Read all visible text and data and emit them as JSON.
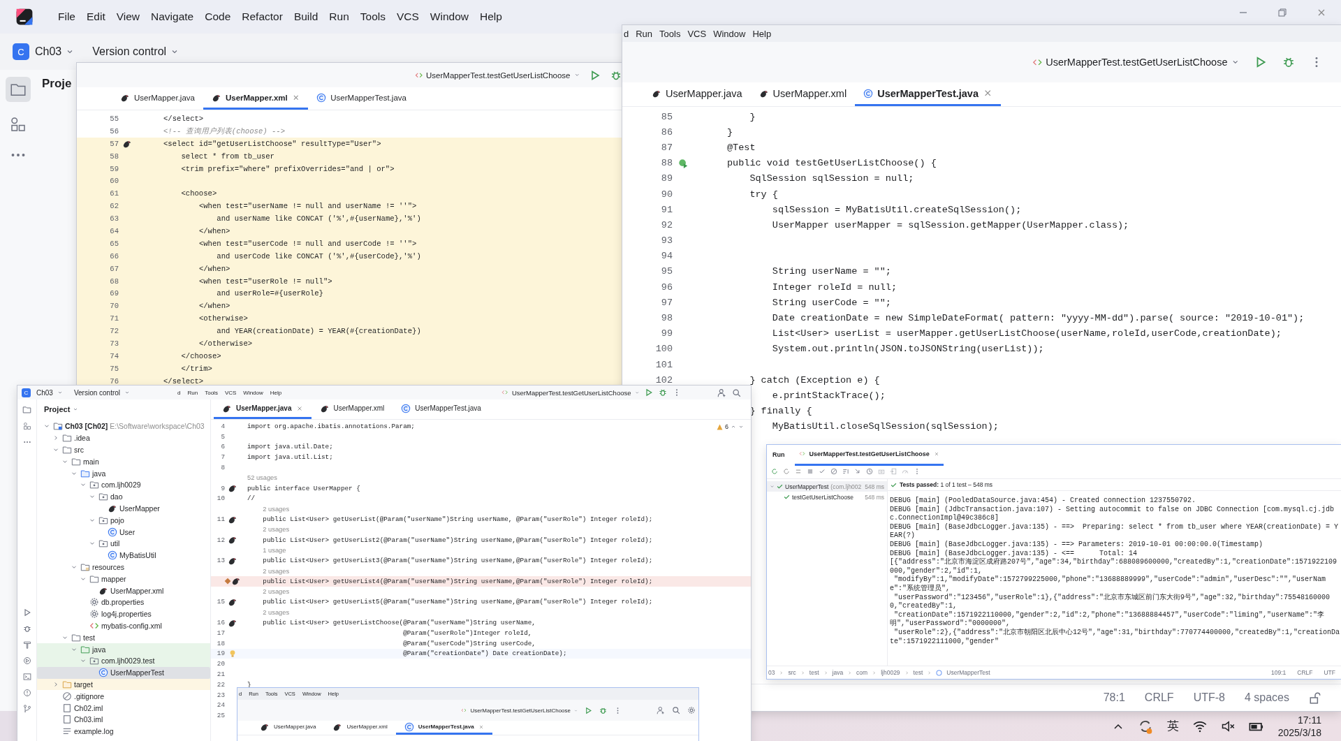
{
  "ide": {
    "menu": [
      "File",
      "Edit",
      "View",
      "Navigate",
      "Code",
      "Refactor",
      "Build",
      "Run",
      "Tools",
      "VCS",
      "Window",
      "Help"
    ],
    "project_letter": "C",
    "project": "Ch03",
    "vcs": "Version control",
    "pane_title": "Proje"
  },
  "xml_window": {
    "run_config": "UserMapperTest.testGetUserListChoose",
    "tabs": [
      {
        "label": "UserMapper.java",
        "kind": "mapper",
        "selected": false
      },
      {
        "label": "UserMapper.xml",
        "kind": "mapper",
        "selected": true
      },
      {
        "label": "UserMapperTest.java",
        "kind": "class",
        "selected": false
      }
    ],
    "lines": [
      {
        "n": "55",
        "text": "</select>",
        "kind": "code",
        "marked": false
      },
      {
        "n": "56",
        "text": "<!-- 查询用户列表(choose) -->",
        "kind": "comment",
        "marked": false
      },
      {
        "n": "57",
        "text": "<select id=\"getUserListChoose\" resultType=\"User\">",
        "kind": "injected",
        "marked": true
      },
      {
        "n": "58",
        "text": "    select * from tb_user",
        "kind": "injected",
        "marked": false
      },
      {
        "n": "59",
        "text": "    <trim prefix=\"where\" prefixOverrides=\"and | or\">",
        "kind": "injected",
        "marked": false
      },
      {
        "n": "60",
        "kind": "injected",
        "marked": false
      },
      {
        "n": "61",
        "text": "    <choose>",
        "kind": "injected",
        "marked": false
      },
      {
        "n": "62",
        "text": "        <when test=\"userName != null and userName != ''\">",
        "kind": "injected",
        "marked": false
      },
      {
        "n": "63",
        "text": "            and userName like CONCAT ('%',#{userName},'%')",
        "kind": "injected",
        "marked": false
      },
      {
        "n": "64",
        "text": "        </when>",
        "kind": "injected",
        "marked": false
      },
      {
        "n": "65",
        "text": "        <when test=\"userCode != null and userCode != ''\">",
        "kind": "injected",
        "marked": false
      },
      {
        "n": "66",
        "text": "            and userCode like CONCAT ('%',#{userCode},'%')",
        "kind": "injected",
        "marked": false
      },
      {
        "n": "67",
        "text": "        </when>",
        "kind": "injected",
        "marked": false
      },
      {
        "n": "68",
        "text": "        <when test=\"userRole != null\">",
        "kind": "injected",
        "marked": false
      },
      {
        "n": "69",
        "text": "            and userRole=#{userRole}",
        "kind": "injected",
        "marked": false
      },
      {
        "n": "70",
        "text": "        </when>",
        "kind": "injected",
        "marked": false
      },
      {
        "n": "71",
        "text": "        <otherwise>",
        "kind": "injected",
        "marked": false
      },
      {
        "n": "72",
        "text": "            and YEAR(creationDate) = YEAR(#{creationDate})",
        "kind": "injected",
        "marked": false
      },
      {
        "n": "73",
        "text": "        </otherwise>",
        "kind": "injected",
        "marked": false
      },
      {
        "n": "74",
        "text": "    </choose>",
        "kind": "injected",
        "marked": false
      },
      {
        "n": "75",
        "text": "    </trim>",
        "kind": "injected",
        "marked": false
      },
      {
        "n": "76",
        "text": "</select>",
        "kind": "injected",
        "marked": false
      }
    ]
  },
  "test_window": {
    "menu": [
      "d",
      "Run",
      "Tools",
      "VCS",
      "Window",
      "Help"
    ],
    "run_config": "UserMapperTest.testGetUserListChoose",
    "tabs": [
      {
        "label": "UserMapper.java",
        "kind": "mapper",
        "selected": false
      },
      {
        "label": "UserMapper.xml",
        "kind": "mapper",
        "selected": false
      },
      {
        "label": "UserMapperTest.java",
        "kind": "class",
        "selected": true
      }
    ],
    "lines": [
      {
        "n": "85",
        "text": "    }",
        "kind": "code",
        "marked": false
      },
      {
        "n": "86",
        "text": "}",
        "kind": "code",
        "marked": false
      },
      {
        "n": "87",
        "text": "@Test",
        "kind": "code",
        "marked": false
      },
      {
        "n": "88",
        "text": "public void testGetUserListChoose() {",
        "kind": "code",
        "marked": true
      },
      {
        "n": "89",
        "text": "    SqlSession sqlSession = null;",
        "kind": "code",
        "marked": false
      },
      {
        "n": "90",
        "text": "    try {",
        "kind": "code",
        "marked": false
      },
      {
        "n": "91",
        "text": "        sqlSession = MyBatisUtil.createSqlSession();",
        "kind": "code",
        "marked": false
      },
      {
        "n": "92",
        "text": "        UserMapper userMapper = sqlSession.getMapper(UserMapper.class);",
        "kind": "code",
        "marked": false
      },
      {
        "n": "93",
        "marked": false
      },
      {
        "n": "94",
        "marked": false
      },
      {
        "n": "95",
        "text": "        String userName = \"\";",
        "kind": "code",
        "marked": false
      },
      {
        "n": "96",
        "text": "        Integer roleId = null;",
        "kind": "code",
        "marked": false
      },
      {
        "n": "97",
        "text": "        String userCode = \"\";",
        "kind": "code",
        "marked": false
      },
      {
        "n": "98",
        "text": "        Date creationDate = new SimpleDateFormat( pattern: \"yyyy-MM-dd\").parse( source: \"2019-10-01\");",
        "kind": "code",
        "marked": false
      },
      {
        "n": "99",
        "text": "        List<User> userList = userMapper.getUserListChoose(userName,roleId,userCode,creationDate);",
        "kind": "code",
        "marked": false
      },
      {
        "n": "100",
        "text": "        System.out.println(JSON.toJSONString(userList));",
        "kind": "code",
        "marked": false
      },
      {
        "n": "101",
        "marked": false
      },
      {
        "n": "102",
        "text": "    } catch (Exception e) {",
        "kind": "code",
        "marked": false
      },
      {
        "text": "        e.printStackTrace();",
        "kind": "code"
      },
      {
        "text": "    } finally {",
        "kind": "code"
      },
      {
        "text": "        MyBatisUtil.closeSqlSession(sqlSession);",
        "kind": "code"
      }
    ],
    "status": [
      "78:1",
      "CRLF",
      "UTF-8",
      "4 spaces"
    ]
  },
  "mapper_window": {
    "project_letter": "C",
    "project": "Ch03",
    "vcs": "Version control",
    "menu": [
      "d",
      "Run",
      "Tools",
      "VCS",
      "Window",
      "Help"
    ],
    "run_config": "UserMapperTest.testGetUserListChoose",
    "tree_title": "Project",
    "tree": [
      {
        "label": "Ch03 [Ch02]",
        "path": "E:\\Software\\workspace\\Ch03",
        "kind": "module",
        "expanded": true,
        "selected": false,
        "children": [
          {
            "label": ".idea",
            "kind": "folder",
            "expanded": false,
            "selected": false
          },
          {
            "label": "src",
            "kind": "folder",
            "expanded": true,
            "selected": false,
            "children": [
              {
                "label": "main",
                "kind": "folder",
                "expanded": true,
                "selected": false,
                "children": [
                  {
                    "label": "java",
                    "kind": "source",
                    "expanded": true,
                    "selected": false,
                    "children": [
                      {
                        "label": "com.ljh0029",
                        "kind": "package",
                        "expanded": true,
                        "selected": false,
                        "children": [
                          {
                            "label": "dao",
                            "kind": "package",
                            "expanded": true,
                            "selected": false,
                            "children": [
                              {
                                "label": "UserMapper",
                                "kind": "mapper",
                                "selected": false
                              }
                            ]
                          },
                          {
                            "label": "pojo",
                            "kind": "package",
                            "expanded": true,
                            "selected": false,
                            "children": [
                              {
                                "label": "User",
                                "kind": "class",
                                "selected": false
                              }
                            ]
                          },
                          {
                            "label": "util",
                            "kind": "package",
                            "expanded": true,
                            "selected": false,
                            "children": [
                              {
                                "label": "MyBatisUtil",
                                "kind": "class",
                                "selected": false
                              }
                            ]
                          }
                        ]
                      }
                    ]
                  },
                  {
                    "label": "resources",
                    "kind": "resources",
                    "expanded": true,
                    "selected": false,
                    "children": [
                      {
                        "label": "mapper",
                        "kind": "folder",
                        "expanded": true,
                        "selected": false,
                        "children": [
                          {
                            "label": "UserMapper.xml",
                            "kind": "mapper",
                            "selected": false
                          }
                        ]
                      },
                      {
                        "label": "db.properties",
                        "kind": "properties",
                        "selected": false
                      },
                      {
                        "label": "log4j.properties",
                        "kind": "properties",
                        "selected": false
                      },
                      {
                        "label": "mybatis-config.xml",
                        "kind": "xml",
                        "selected": false
                      }
                    ]
                  }
                ]
              },
              {
                "label": "test",
                "kind": "folder",
                "expanded": true,
                "selected": false,
                "children": [
                  {
                    "label": "java",
                    "kind": "testsource",
                    "expanded": true,
                    "selected": false,
                    "children": [
                      {
                        "label": "com.ljh0029.test",
                        "kind": "package",
                        "expanded": true,
                        "selected": false,
                        "children": [
                          {
                            "label": "UserMapperTest",
                            "kind": "class",
                            "selected": true
                          }
                        ]
                      }
                    ]
                  }
                ]
              }
            ]
          },
          {
            "label": "target",
            "kind": "excluded",
            "expanded": false,
            "selected": false
          },
          {
            "label": ".gitignore",
            "kind": "ignore",
            "selected": false
          },
          {
            "label": "Ch02.iml",
            "kind": "file",
            "selected": false
          },
          {
            "label": "Ch03.iml",
            "kind": "file",
            "selected": false
          },
          {
            "label": "example.log",
            "kind": "log",
            "selected": false
          }
        ]
      }
    ],
    "tabs": [
      {
        "label": "UserMapper.java",
        "kind": "mapper",
        "selected": true
      },
      {
        "label": "UserMapper.xml",
        "kind": "mapper",
        "selected": false
      },
      {
        "label": "UserMapperTest.java",
        "kind": "class",
        "selected": false
      }
    ],
    "warnings": "6",
    "lines": [
      {
        "n": "4",
        "text": "import org.apache.ibatis.annotations.Param;",
        "kind": "code",
        "marked": false
      },
      {
        "n": "5",
        "marked": false
      },
      {
        "n": "6",
        "text": "import java.util.Date;",
        "kind": "code",
        "marked": false
      },
      {
        "n": "7",
        "text": "import java.util.List;",
        "kind": "code",
        "marked": false
      },
      {
        "n": "8",
        "marked": false
      },
      {
        "text": "52 usages",
        "kind": "hint",
        "marked": false
      },
      {
        "n": "9",
        "text": "public interface UserMapper {",
        "kind": "code",
        "marked": true
      },
      {
        "n": "10",
        "text": "//",
        "kind": "code",
        "marked": false
      },
      {
        "text": "    2 usages",
        "kind": "hint",
        "marked": false
      },
      {
        "n": "11",
        "text": "    public List<User> getUserList(@Param(\"userName\")String userName, @Param(\"userRole\") Integer roleId);",
        "kind": "code",
        "marked": true
      },
      {
        "text": "    2 usages",
        "kind": "hint",
        "marked": false
      },
      {
        "n": "12",
        "text": "    public List<User> getUserList2(@Param(\"userName\")String userName,@Param(\"userRole\") Integer roleId);",
        "kind": "code",
        "marked": true
      },
      {
        "text": "    1 usage",
        "kind": "hint",
        "marked": false
      },
      {
        "n": "13",
        "text": "    public List<User> getUserList3(@Param(\"userName\")String userName,@Param(\"userRole\") Integer roleId);",
        "kind": "code",
        "marked": true
      },
      {
        "text": "    2 usages",
        "kind": "hint",
        "marked": false
      },
      {
        "text": "    public List<User> getUserList4(@Param(\"userName\")String userName,@Param(\"userRole\") Integer roleId);",
        "kind": "breakpoint",
        "marked": true
      },
      {
        "text": "    2 usages",
        "kind": "hint",
        "marked": false
      },
      {
        "n": "15",
        "text": "    public List<User> getUserList5(@Param(\"userName\")String userName,@Param(\"userRole\") Integer roleId);",
        "kind": "code",
        "marked": true
      },
      {
        "text": "    2 usages",
        "kind": "hint",
        "marked": false
      },
      {
        "n": "16",
        "text": "    public List<User> getUserListChoose(@Param(\"userName\")String userName,",
        "kind": "code",
        "marked": true
      },
      {
        "n": "17",
        "text": "                                        @Param(\"userRole\")Integer roleId,",
        "kind": "code",
        "marked": false
      },
      {
        "n": "18",
        "text": "                                        @Param(\"userCode\")String userCode,",
        "kind": "code",
        "marked": false
      },
      {
        "n": "19",
        "text": "                                        @Param(\"creationDate\") Date creationDate);",
        "kind": "current",
        "marked": false
      },
      {
        "n": "20",
        "marked": false
      },
      {
        "n": "21",
        "marked": false
      },
      {
        "n": "22",
        "text": "}",
        "kind": "code",
        "marked": false
      },
      {
        "n": "23",
        "marked": false
      },
      {
        "n": "24",
        "marked": false
      },
      {
        "n": "25",
        "marked": false
      }
    ],
    "nested_window": {
      "menu": [
        "d",
        "Run",
        "Tools",
        "VCS",
        "Window",
        "Help"
      ],
      "run_config": "UserMapperTest.testGetUserListChoose",
      "tabs": [
        {
          "label": "UserMapper.java",
          "kind": "mapper",
          "selected": false
        },
        {
          "label": "UserMapper.xml",
          "kind": "mapper",
          "selected": false
        },
        {
          "label": "UserMapperTest.java",
          "kind": "class",
          "selected": true
        }
      ]
    }
  },
  "run_panel": {
    "title": "Run",
    "tab": "UserMapperTest.testGetUserListChoose",
    "tests": [
      {
        "label": "UserMapperTest",
        "package": "(com.ljh002",
        "time": "548 ms",
        "passed": true,
        "children": [
          {
            "label": "testGetUserListChoose",
            "time": "548 ms",
            "passed": true
          }
        ]
      }
    ],
    "summary": "**Tests passed:** 1 of 1 test – 548 ms",
    "log": [
      "DEBUG [main] (PooledDataSource.java:454) - Created connection 1237550792.",
      "DEBUG [main] (JdbcTransaction.java:107) - Setting autocommit to false on JDBC Connection [com.mysql.cj.jdbc.ConnectionImpl@49c386c8]",
      "DEBUG [main] (BaseJdbcLogger.java:135) - ==>  Preparing: select * from tb_user where YEAR(creationDate) = YEAR(?)",
      "DEBUG [main] (BaseJdbcLogger.java:135) - ==> Parameters: 2019-10-01 00:00:00.0(Timestamp)",
      "DEBUG [main] (BaseJdbcLogger.java:135) - <==      Total: 14",
      "[{\"address\":\"北京市海淀区成府路207号\",\"age\":34,\"birthday\":688089600000,\"createdBy\":1,\"creationDate\":1571922109000,\"gender\":2,\"id\":1,",
      " \"modifyBy\":1,\"modifyDate\":1572799225000,\"phone\":\"13688889999\",\"userCode\":\"admin\",\"userDesc\":\"\",\"userName\":\"系统管理员\",",
      " \"userPassword\":\"123456\",\"userRole\":1},{\"address\":\"北京市东城区前门东大街9号\",\"age\":32,\"birthday\":755481600000,\"createdBy\":1,",
      " \"creationDate\":1571922110000,\"gender\":2,\"id\":2,\"phone\":\"13688884457\",\"userCode\":\"liming\",\"userName\":\"李明\",\"userPassword\":\"0000000\",",
      " \"userRole\":2},{\"address\":\"北京市朝阳区北辰中心12号\",\"age\":31,\"birthday\":770774400000,\"createdBy\":1,\"creationDate\":1571922111000,\"gender\""
    ],
    "breadcrumb": [
      "03",
      "src",
      "test",
      "java",
      "com",
      "ljh0029",
      "test",
      "UserMapperTest"
    ],
    "status": [
      "109:1",
      "CRLF",
      "UTF"
    ]
  },
  "taskbar": {
    "ime": "英",
    "time": "17:11",
    "date": "2025/3/18"
  }
}
